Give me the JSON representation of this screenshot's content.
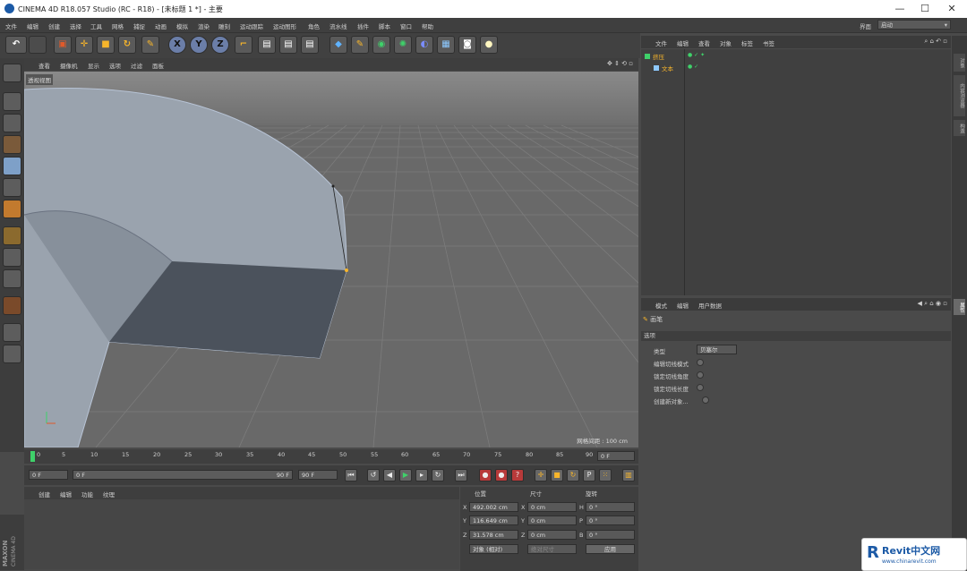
{
  "window": {
    "title": "CINEMA 4D R18.057 Studio (RC - R18) - [未标题 1 *] - 主要",
    "minimize": "—",
    "maximize": "☐",
    "close": "✕"
  },
  "menubar": {
    "items": [
      "文件",
      "编辑",
      "创建",
      "选择",
      "工具",
      "网格",
      "捕捉",
      "动画",
      "模拟",
      "渲染",
      "雕刻",
      "运动跟踪",
      "运动图形",
      "角色",
      "流水线",
      "插件",
      "脚本",
      "窗口",
      "帮助"
    ],
    "layout_label": "界面",
    "layout_value": "启动"
  },
  "toolbar": {
    "x": "X",
    "y": "Y",
    "z": "Z"
  },
  "viewport": {
    "menu": [
      "查看",
      "摄像机",
      "显示",
      "选项",
      "过滤",
      "面板"
    ],
    "title": "透视视图",
    "grid_label": "网格间距 : 100 cm"
  },
  "timeline": {
    "ticks": [
      "0",
      "5",
      "10",
      "15",
      "20",
      "25",
      "30",
      "35",
      "40",
      "45",
      "50",
      "55",
      "60",
      "65",
      "70",
      "75",
      "80",
      "85",
      "90"
    ],
    "end_field": "0 F",
    "start": "0 F",
    "current": "0 F",
    "range_end": "90 F",
    "max": "90 F"
  },
  "materials": {
    "menu": [
      "创建",
      "编辑",
      "功能",
      "纹理"
    ]
  },
  "coords": {
    "headers": [
      "位置",
      "尺寸",
      "旋转"
    ],
    "rows": [
      {
        "axis": "X",
        "pos": "492.002 cm",
        "size_axis": "X",
        "size": "0 cm",
        "rot_axis": "H",
        "rot": "0 °"
      },
      {
        "axis": "Y",
        "pos": "116.649 cm",
        "size_axis": "Y",
        "size": "0 cm",
        "rot_axis": "P",
        "rot": "0 °"
      },
      {
        "axis": "Z",
        "pos": "31.578 cm",
        "size_axis": "Z",
        "size": "0 cm",
        "rot_axis": "B",
        "rot": "0 °"
      }
    ],
    "mode": "对象 (相对)",
    "size_mode": "绝对尺寸",
    "apply": "应用"
  },
  "objects": {
    "menu": [
      "文件",
      "编辑",
      "查看",
      "对象",
      "标签",
      "书签"
    ],
    "items": [
      {
        "name": "挤压"
      },
      {
        "name": "文本"
      }
    ]
  },
  "attributes": {
    "menu": [
      "模式",
      "编辑",
      "用户数据"
    ],
    "tool_name": "画笔",
    "section": "选项",
    "type_label": "类型",
    "type_value": "贝塞尔",
    "options": [
      "编辑切线模式",
      "锁定切线角度",
      "锁定切线长度",
      "创建新对象..."
    ]
  },
  "sidetabs": [
    "对象",
    "内容浏览器",
    "构造"
  ],
  "side_attr_tab": "属性",
  "logo": {
    "brand": "MAXON",
    "product": "CINEMA 4D"
  },
  "watermark": {
    "name": "Revit中文网",
    "url": "www.chinarevit.com"
  },
  "colors": {
    "accent": "#f7b52b",
    "select": "#6b7ea8",
    "watermark": "#1c5aa6"
  }
}
